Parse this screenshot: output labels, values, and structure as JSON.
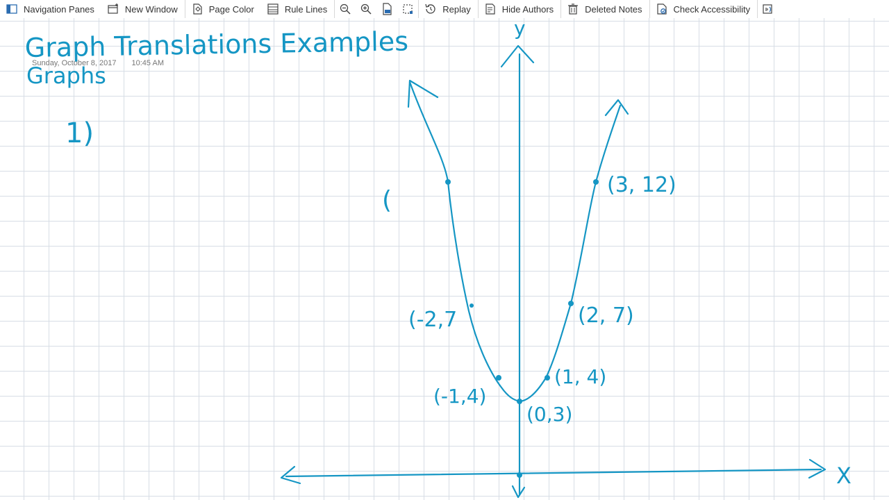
{
  "toolbar": {
    "navigation_panes": "Navigation Panes",
    "new_window": "New Window",
    "page_color": "Page Color",
    "rule_lines": "Rule Lines",
    "replay": "Replay",
    "hide_authors": "Hide Authors",
    "deleted_notes": "Deleted Notes",
    "check_accessibility": "Check Accessibility"
  },
  "page": {
    "title": "Graph Translations Examples",
    "subtitle": "Graphs",
    "date": "Sunday, October 8, 2017",
    "time": "10:45 AM",
    "problem_number": "1)"
  },
  "graph": {
    "y_axis_label": "y",
    "x_axis_label": "X",
    "stray_paren": "(",
    "points": [
      {
        "label": "(3, 12)"
      },
      {
        "label": "(2, 7)"
      },
      {
        "label": "(-2,7"
      },
      {
        "label": "(1, 4)"
      },
      {
        "label": "(-1,4)"
      },
      {
        "label": "(0,3)"
      }
    ]
  },
  "colors": {
    "ink": "#1596c4",
    "grid": "#d7dde5"
  }
}
